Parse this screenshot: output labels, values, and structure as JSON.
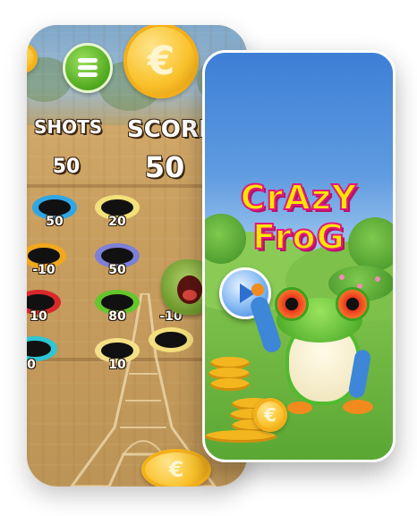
{
  "game_board": {
    "shots_label": "SHOTS",
    "shots_value": "50",
    "score_label": "SCORE",
    "score_value": "50",
    "menu_icon": "list-menu-icon",
    "coin_symbol": "€",
    "holes": [
      {
        "value": "50",
        "color": "#2fa7e6"
      },
      {
        "value": "20",
        "color": "#f2e07a"
      },
      {
        "value": "-10",
        "color": "#f1a81d"
      },
      {
        "value": "50",
        "color": "#7e7fd6"
      },
      {
        "value": "10",
        "color": "#d9282a"
      },
      {
        "value": "80",
        "color": "#66c52c"
      },
      {
        "value": "-10",
        "color": "#f4df7c"
      },
      {
        "value": "0",
        "color": "#2ec6d4"
      },
      {
        "value": "10",
        "color": "#f4e086"
      }
    ]
  },
  "title_screen": {
    "title_line1": "CrAzY",
    "title_line2": "FroG",
    "play_icon": "play-icon",
    "coin_symbol": "€"
  },
  "colors": {
    "title_fill": "#ffe600",
    "title_stroke": "#e01b7c",
    "sky": "#3d7fd6",
    "grass": "#5aa733",
    "wood": "#caa060"
  }
}
